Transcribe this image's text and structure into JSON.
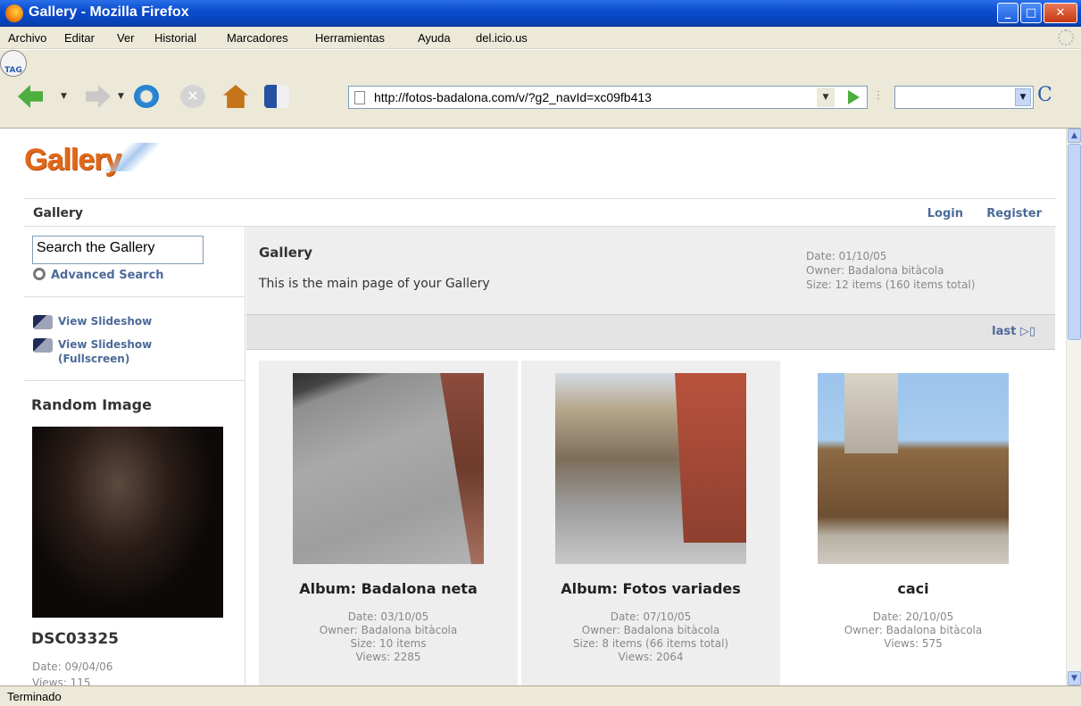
{
  "window": {
    "title": "Gallery - Mozilla Firefox"
  },
  "menu": [
    "Archivo",
    "Editar",
    "Ver",
    "Historial",
    "Marcadores",
    "Herramientas",
    "Ayuda",
    "del.icio.us"
  ],
  "toolbar": {
    "url": "http://fotos-badalona.com/v/?g2_navId=xc09fb413",
    "tag_label": "TAG",
    "search_engine_glyph": "C"
  },
  "status": {
    "text": "Terminado"
  },
  "gallery": {
    "logo_text": "Gallery",
    "breadcrumb": "Gallery",
    "login": "Login",
    "register": "Register",
    "sidebar": {
      "search_value": "Search the Gallery",
      "advanced_search": "Advanced Search",
      "slideshow": "View Slideshow",
      "slideshow_fullscreen_1": "View Slideshow",
      "slideshow_fullscreen_2": "(Fullscreen)",
      "random_title": "Random Image",
      "random_name": "DSC03325",
      "random_date": "Date: 09/04/06",
      "random_views": "Views: 115"
    },
    "header": {
      "title": "Gallery",
      "description": "This is the main page of your Gallery",
      "date": "Date: 01/10/05",
      "owner": "Owner: Badalona bitàcola",
      "size": "Size: 12 items (160 items total)"
    },
    "pager": {
      "last": "last"
    },
    "items": [
      {
        "title": "Album: Badalona neta",
        "date": "Date: 03/10/05",
        "owner": "Owner: Badalona bitàcola",
        "size": "Size: 10 items",
        "views": "Views: 2285"
      },
      {
        "title": "Album: Fotos variades",
        "date": "Date: 07/10/05",
        "owner": "Owner: Badalona bitàcola",
        "size": "Size: 8 items (66 items total)",
        "views": "Views: 2064"
      },
      {
        "title": "caci",
        "date": "Date: 20/10/05",
        "owner": "Owner: Badalona bitàcola",
        "views": "Views: 575"
      }
    ]
  }
}
